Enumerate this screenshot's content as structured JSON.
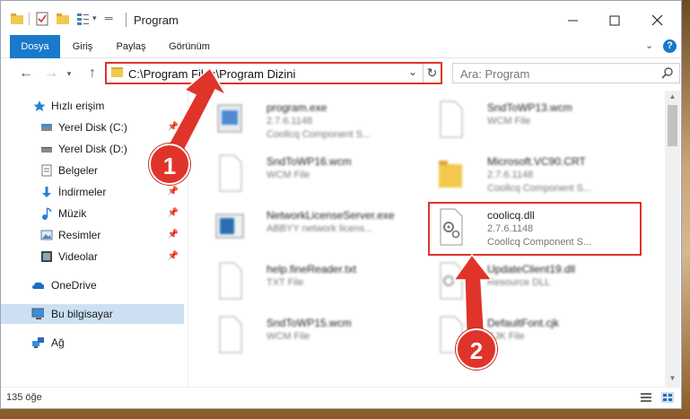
{
  "window": {
    "title": "Program",
    "quick_access": [
      "folder-icon",
      "properties-icon",
      "new-folder-icon",
      "customize-icon"
    ]
  },
  "ribbon": {
    "tabs": [
      {
        "label": "Dosya",
        "active": true
      },
      {
        "label": "Giriş",
        "active": false
      },
      {
        "label": "Paylaş",
        "active": false
      },
      {
        "label": "Görünüm",
        "active": false
      }
    ]
  },
  "address": {
    "path": "C:\\Program Files\\Program Dizini"
  },
  "search": {
    "placeholder": "Ara: Program"
  },
  "sidebar": {
    "items": [
      {
        "label": "Hızlı erişim",
        "icon": "star-icon",
        "pinned": false,
        "selected": false
      },
      {
        "label": "Yerel Disk (C:)",
        "icon": "drive-icon",
        "pinned": true,
        "selected": false
      },
      {
        "label": "Yerel Disk (D:)",
        "icon": "drive-icon",
        "pinned": true,
        "selected": false
      },
      {
        "label": "Belgeler",
        "icon": "documents-icon",
        "pinned": true,
        "selected": false
      },
      {
        "label": "İndirmeler",
        "icon": "downloads-icon",
        "pinned": true,
        "selected": false
      },
      {
        "label": "Müzik",
        "icon": "music-icon",
        "pinned": true,
        "selected": false
      },
      {
        "label": "Resimler",
        "icon": "pictures-icon",
        "pinned": true,
        "selected": false
      },
      {
        "label": "Videolar",
        "icon": "videos-icon",
        "pinned": true,
        "selected": false
      },
      {
        "label": "OneDrive",
        "icon": "cloud-icon",
        "pinned": false,
        "selected": false
      },
      {
        "label": "Bu bilgisayar",
        "icon": "computer-icon",
        "pinned": false,
        "selected": true
      },
      {
        "label": "Ağ",
        "icon": "network-icon",
        "pinned": false,
        "selected": false
      }
    ]
  },
  "files": [
    {
      "name": "program.exe",
      "line2": "2.7.6.1148",
      "line3": "Coollcq Component S...",
      "icon": "exe-icon",
      "blurred": true
    },
    {
      "name": "SndToWP13.wcm",
      "line2": "WCM File",
      "line3": "",
      "icon": "file-icon",
      "blurred": true
    },
    {
      "name": "SndToWP16.wcm",
      "line2": "WCM File",
      "line3": "",
      "icon": "file-icon",
      "blurred": true
    },
    {
      "name": "Microsoft.VC90.CRT",
      "line2": "2.7.6.1148",
      "line3": "Coollcq Component S...",
      "icon": "folder-icon",
      "blurred": true
    },
    {
      "name": "NetworkLicenseServer.exe",
      "line2": "ABBYY network licens...",
      "line3": "",
      "icon": "app-icon",
      "blurred": true
    },
    {
      "name": "coolicq.dll",
      "line2": "2.7.6.1148",
      "line3": "Coollcq Component S...",
      "icon": "dll-icon",
      "blurred": false
    },
    {
      "name": "help.fineReader.txt",
      "line2": "TXT File",
      "line3": "",
      "icon": "file-icon",
      "blurred": true
    },
    {
      "name": "UpdateClient19.dll",
      "line2": "Resource DLL",
      "line3": "",
      "icon": "dll-icon",
      "blurred": true
    },
    {
      "name": "SndToWP15.wcm",
      "line2": "WCM File",
      "line3": "",
      "icon": "file-icon",
      "blurred": true
    },
    {
      "name": "DefaultFont.cjk",
      "line2": "CJK File",
      "line3": "",
      "icon": "file-icon",
      "blurred": true
    }
  ],
  "status": {
    "count": "135 öğe"
  },
  "annotations": [
    {
      "label": "1"
    },
    {
      "label": "2"
    }
  ],
  "colors": {
    "accent": "#1979ca",
    "highlight": "#e0332a",
    "selected": "#cce0f2"
  }
}
